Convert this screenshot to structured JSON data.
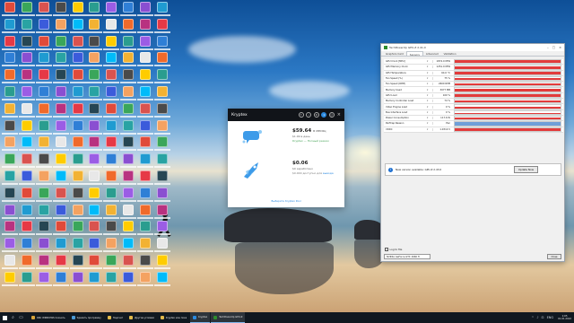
{
  "desktop": {
    "icon_colors": [
      "#e04a3a",
      "#2f7fd6",
      "#f2b233",
      "#3aa65a",
      "#8a4fd1",
      "#e8e8e8",
      "#d9534f",
      "#1f9bd1",
      "#f06a2b",
      "#4a4a4a",
      "#29a3a3",
      "#b83280",
      "#ffcc00",
      "#3b5bdb",
      "#e63946",
      "#2a9d8f",
      "#f4a261",
      "#264653",
      "#9b5de5",
      "#00bbf9"
    ],
    "columns": 10,
    "rows": 17
  },
  "kryptex": {
    "title": "Кryptex",
    "header_buttons": [
      "gift-icon",
      "bell-icon",
      "settings-icon",
      "notification-icon",
      "user-icon"
    ],
    "close_glyph": "×",
    "monthly": {
      "amount": "$59.64",
      "period": "в месяц",
      "sub": "$1.99 в день",
      "status": "Кryptex — Полный режим"
    },
    "balance": {
      "amount": "$0.06",
      "sub": "$0 заработано",
      "note_prefix": "$0.000 доступно для",
      "note_link": "вывода"
    },
    "footer": "Выберите Кryptex Pool"
  },
  "gpuz": {
    "title": "TechPowerUp GPU-Z 2.41.0",
    "window_controls": [
      "–",
      "□",
      "×"
    ],
    "tabs": [
      "Graphics Card",
      "Sensors",
      "Advanced",
      "Validation"
    ],
    "active_tab": "Sensors",
    "sensors": [
      {
        "name": "GPU Clock [MHz]",
        "value": "1874.0 MHz",
        "level": 0.92,
        "color": "#e23b3b"
      },
      {
        "name": "GPU Memory Clock",
        "value": "1251.0 MHz",
        "level": 0.9,
        "color": "#e23b3b"
      },
      {
        "name": "GPU Temperature",
        "value": "64.0 °C",
        "level": 0.8,
        "color": "#e23b3b"
      },
      {
        "name": "Fan Speed (%)",
        "value": "75 %",
        "level": 0.75,
        "color": "#e23b3b"
      },
      {
        "name": "Fan Speed (RPM)",
        "value": "2600 RPM",
        "level": 0.7,
        "color": "#e23b3b"
      },
      {
        "name": "Memory Used",
        "value": "3077 MB",
        "level": 0.85,
        "color": "#e23b3b"
      },
      {
        "name": "GPU Load",
        "value": "100 %",
        "level": 0.95,
        "color": "#e23b3b"
      },
      {
        "name": "Memory Controller Load",
        "value": "74 %",
        "level": 0.85,
        "color": "#e23b3b"
      },
      {
        "name": "Video Engine Load",
        "value": "0 %",
        "level": 0.6,
        "color": "#e23b3b"
      },
      {
        "name": "Bus Interface Load",
        "value": "0 %",
        "level": 0.35,
        "color": "#e23b3b"
      },
      {
        "name": "Power Consumption",
        "value": "117.6 W",
        "level": 0.8,
        "color": "#e23b3b"
      },
      {
        "name": "PerfCap Reason",
        "value": "Pwr",
        "level": 1.0,
        "color": "#6f9fd8"
      },
      {
        "name": "VDDC",
        "value": "1.0310 V",
        "level": 0.9,
        "color": "#e23b3b"
      }
    ],
    "notification": "New version available: GPU-Z 2.43.0",
    "update_button": "Update Now",
    "log_label": "Log to file",
    "device": "NVIDIA GeForce GTX 1660 Ti",
    "close_button": "Close"
  },
  "taskbar": {
    "items": [
      {
        "label": "RKU WINDOWS Скачать",
        "color": "#d7a43a",
        "active": false
      },
      {
        "label": "Удалить программу",
        "color": "#4a9ad6",
        "active": false
      },
      {
        "label": "Подсчет",
        "color": "#e0b84a",
        "active": false
      },
      {
        "label": "Другие условия",
        "color": "#e0b84a",
        "active": false
      },
      {
        "label": "Kryptex мое пока",
        "color": "#e0b84a",
        "active": false
      },
      {
        "label": "Kryptex",
        "color": "#2a8ae0",
        "active": true
      },
      {
        "label": "TechPowerUp GPU-Z",
        "color": "#2d8c2d",
        "active": true
      }
    ],
    "tray_icons": [
      "^",
      "♪",
      "⊡",
      "ENG"
    ],
    "time": "1:05",
    "date": "01.01.2022"
  }
}
